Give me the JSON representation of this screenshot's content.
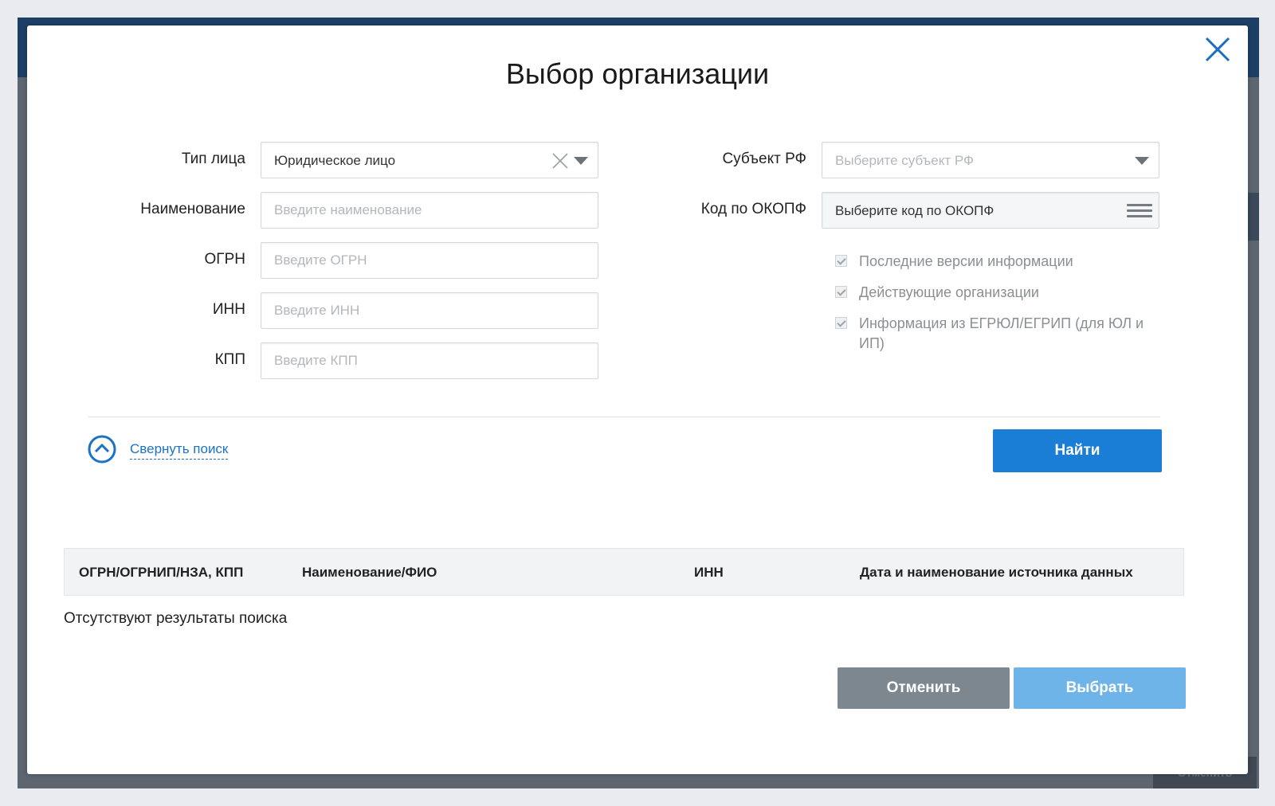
{
  "background": {
    "button_label": "Отменить"
  },
  "modal": {
    "title": "Выбор организации",
    "close_icon": "close-icon"
  },
  "form": {
    "entity_type": {
      "label": "Тип лица",
      "value": "Юридическое лицо"
    },
    "name": {
      "label": "Наименование",
      "placeholder": "Введите наименование"
    },
    "ogrn": {
      "label": "ОГРН",
      "placeholder": "Введите ОГРН"
    },
    "inn": {
      "label": "ИНН",
      "placeholder": "Введите ИНН"
    },
    "kpp": {
      "label": "КПП",
      "placeholder": "Введите КПП"
    },
    "region": {
      "label": "Субъект РФ",
      "placeholder": "Выберите субъект РФ"
    },
    "okopf": {
      "label": "Код по ОКОПФ",
      "value": "Выберите код по ОКОПФ"
    },
    "checkboxes": [
      {
        "label": "Последние версии информации",
        "checked": true
      },
      {
        "label": "Действующие организации",
        "checked": true
      },
      {
        "label": "Информация из ЕГРЮЛ/ЕГРИП (для ЮЛ и ИП)",
        "checked": true
      }
    ]
  },
  "actions": {
    "collapse_label": "Свернуть поиск",
    "find_label": "Найти",
    "cancel_label": "Отменить",
    "select_label": "Выбрать"
  },
  "table": {
    "columns": [
      "ОГРН/ОГРНИП/НЗА, КПП",
      "Наименование/ФИО",
      "ИНН",
      "Дата и наименование источника данных"
    ],
    "empty_message": "Отсутствуют результаты поиска"
  },
  "colors": {
    "primary": "#1a7ed6",
    "primary_disabled": "#6fb4e8",
    "secondary": "#7d8790",
    "link": "#1a73c4"
  }
}
